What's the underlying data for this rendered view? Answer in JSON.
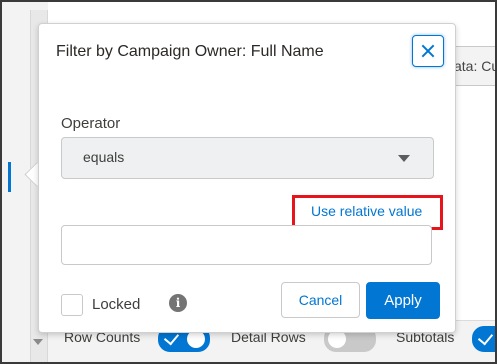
{
  "popover": {
    "title": "Filter by Campaign Owner: Full Name",
    "operator_label": "Operator",
    "operator_value": "equals",
    "relative_link": "Use relative value",
    "value_input": "",
    "locked_label": "Locked",
    "cancel_label": "Cancel",
    "apply_label": "Apply"
  },
  "background": {
    "header_pill_text": "ata: Cu",
    "toggles": [
      {
        "label": "Row Counts",
        "state": "on"
      },
      {
        "label": "Detail Rows",
        "state": "off"
      },
      {
        "label": "Subtotals",
        "state": "on"
      }
    ]
  },
  "colors": {
    "accent": "#0176d3",
    "highlight": "#e8141c"
  },
  "icons": {
    "close": "close-icon",
    "info": "info-icon",
    "dropdown": "chevron-down-icon"
  }
}
